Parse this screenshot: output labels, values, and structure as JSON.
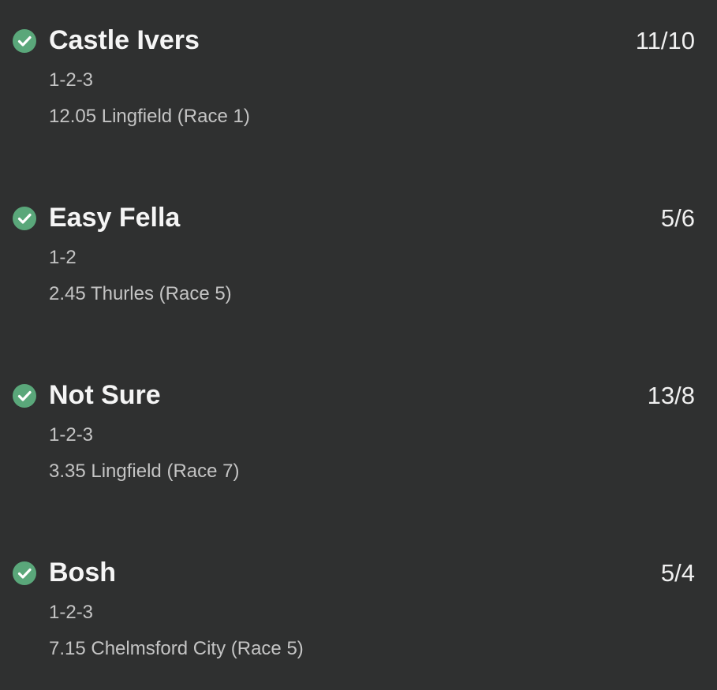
{
  "colors": {
    "background": "#2f3030",
    "check_icon": "#5aa77a",
    "primary_text": "#f5f5f5",
    "secondary_text": "#c4c4c4"
  },
  "selections": [
    {
      "icon": "check-circle-icon",
      "runner": "Castle Ivers",
      "odds": "11/10",
      "places": "1-2-3",
      "race": "12.05 Lingfield (Race 1)"
    },
    {
      "icon": "check-circle-icon",
      "runner": "Easy Fella",
      "odds": "5/6",
      "places": "1-2",
      "race": "2.45 Thurles (Race 5)"
    },
    {
      "icon": "check-circle-icon",
      "runner": "Not Sure",
      "odds": "13/8",
      "places": "1-2-3",
      "race": "3.35 Lingfield (Race 7)"
    },
    {
      "icon": "check-circle-icon",
      "runner": "Bosh",
      "odds": "5/4",
      "places": "1-2-3",
      "race": "7.15 Chelmsford City (Race 5)"
    }
  ]
}
